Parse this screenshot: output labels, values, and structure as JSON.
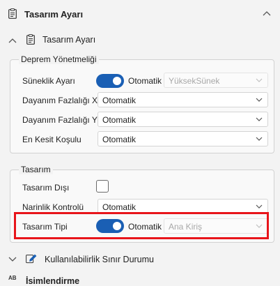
{
  "panel": {
    "title": "Tasarım Ayarı",
    "subsection_title": "Tasarım Ayarı"
  },
  "deprem_group": {
    "title": "Deprem Yönetmeliği",
    "suneklik": {
      "label": "Süneklik Ayarı",
      "toggle_on": true,
      "toggle_label": "Otomatik",
      "dropdown_value": "YüksekSünek",
      "dropdown_disabled": true
    },
    "dayanim_x": {
      "label": "Dayanım Fazlalığı X",
      "value": "Otomatik"
    },
    "dayanim_y": {
      "label": "Dayanım Fazlalığı Y",
      "value": "Otomatik"
    },
    "en_kesit": {
      "label": "En Kesit Koşulu",
      "value": "Otomatik"
    }
  },
  "tasarim_group": {
    "title": "Tasarım",
    "tasarim_disi": {
      "label": "Tasarım Dışı",
      "checked": false
    },
    "narinlik": {
      "label": "Narinlik Kontrolü",
      "value": "Otomatik"
    },
    "tasarim_tipi": {
      "label": "Tasarım Tipi",
      "toggle_on": true,
      "toggle_label": "Otomatik",
      "dropdown_value": "Ana Kiriş",
      "dropdown_disabled": true
    }
  },
  "footer": {
    "kullanilabilirlik": "Kullanılabilirlik Sınır Durumu",
    "isimlendirme": "İsimlendirme",
    "isimlendirme_icon_text": "AB"
  },
  "colors": {
    "toggle_on": "#1a5fb4",
    "highlight": "#e8151b",
    "accent_icon": "#1a5fb4"
  },
  "icons": {
    "header": "clipboard-icon",
    "collapse": "chevron-up-icon",
    "edit": "pencil-icon",
    "dropdown": "chevron-down-icon"
  }
}
